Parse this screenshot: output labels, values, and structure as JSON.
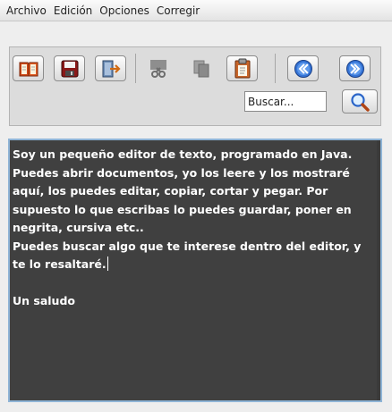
{
  "menubar": {
    "items": [
      "Archivo",
      "Edición",
      "Opciones",
      "Corregir"
    ]
  },
  "toolbar": {
    "buttons": [
      {
        "icon": "open-book-icon",
        "enabled": true
      },
      {
        "icon": "save-disk-icon",
        "enabled": true
      },
      {
        "icon": "exit-door-icon",
        "enabled": true
      },
      {
        "icon": "cut-scissors-icon",
        "enabled": false
      },
      {
        "icon": "copy-pages-icon",
        "enabled": false
      },
      {
        "icon": "paste-clipboard-icon",
        "enabled": true
      },
      {
        "icon": "previous-match-icon",
        "enabled": true
      },
      {
        "icon": "next-match-icon",
        "enabled": true
      }
    ]
  },
  "search": {
    "value": "Buscar...",
    "button_icon": "magnifier-icon"
  },
  "editor": {
    "text": "Soy un pequeño editor de texto, programado en Java.\nPuedes abrir documentos, yo los leere y los mostraré aquí, los puedes editar, copiar, cortar y pegar. Por supuesto lo que escribas lo puedes guardar, poner en negrita, cursiva etc..\nPuedes buscar algo que te interese dentro del editor, y te lo resaltaré.",
    "text_after_caret": "\n\nUn saludo",
    "background": "#404040",
    "foreground": "#ffffff",
    "border_color": "#8fb4d6"
  },
  "colors": {
    "window_bg": "#eeeeee",
    "panel_bg": "#dcdcdc",
    "accent_blue": "#2a64c8"
  }
}
